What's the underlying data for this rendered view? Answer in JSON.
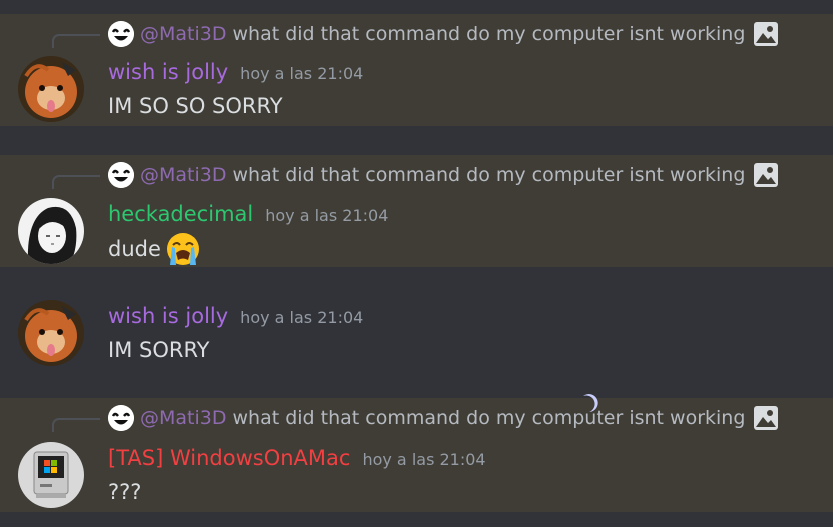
{
  "colors": {
    "background": "#313338",
    "highlight": "#3f3d35",
    "mention_purple": "#8e6ab1",
    "text": "#dbdee1",
    "muted": "#949ba4"
  },
  "messages": [
    {
      "reply": {
        "mention": "@Mati3D",
        "text": "what did that command do my computer isnt working",
        "attachment_icon": "image-icon"
      },
      "author": "wish is jolly",
      "author_color": "#a86adf",
      "timestamp": "hoy a las 21:04",
      "content": "IM SO SO SORRY"
    },
    {
      "reply": {
        "mention": "@Mati3D",
        "text": "what did that command do my computer isnt working",
        "attachment_icon": "image-icon"
      },
      "author": "heckadecimal",
      "author_color": "#2dc770",
      "timestamp": "hoy a las 21:04",
      "content": "dude",
      "emoji": "loudly-crying-face-emoji"
    },
    {
      "author": "wish is jolly",
      "author_color": "#a86adf",
      "timestamp": "hoy a las 21:04",
      "content": "IM SORRY"
    },
    {
      "reply": {
        "mention": "@Mati3D",
        "text": "what did that command do my computer isnt working",
        "attachment_icon": "image-icon"
      },
      "author": "[TAS] WindowsOnAMac",
      "author_color": "#f23f42",
      "timestamp": "hoy a las 21:04",
      "content": "???"
    }
  ]
}
